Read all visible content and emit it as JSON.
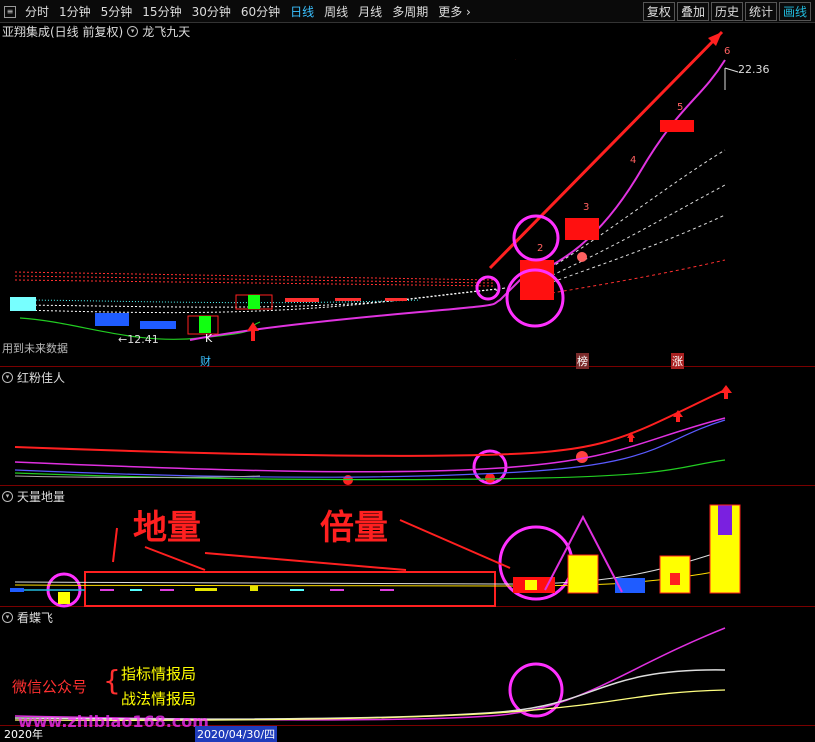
{
  "toolbar": {
    "periods": [
      "分时",
      "1分钟",
      "5分钟",
      "15分钟",
      "30分钟",
      "60分钟",
      "日线",
      "周线",
      "月线",
      "多周期",
      "更多"
    ],
    "active_period": "日线",
    "right_buttons": [
      "复权",
      "叠加",
      "历史",
      "统计",
      "画线"
    ]
  },
  "main_panel": {
    "stock_title": "亚翔集成(日线 前复权)",
    "indicator": "龙飞九天",
    "high_label": "22.36",
    "low_label": "12.41",
    "future_data_label": "用到未来数据",
    "k_label": "K",
    "wave_numbers": [
      "2",
      "3",
      "4",
      "5",
      "6"
    ],
    "bottom_tags": [
      "财",
      "榜",
      "涨"
    ]
  },
  "panel2": {
    "title": "红粉佳人"
  },
  "panel3": {
    "title": "天量地量",
    "annot_diliang": "地量",
    "annot_beiliang": "倍量"
  },
  "panel4": {
    "title": "看蝶飞",
    "wechat_label": "微信公众号",
    "account1": "指标情报局",
    "account2": "战法情报局",
    "watermark": "www.zhibiao168.com"
  },
  "axis": {
    "year_label": "2020年",
    "date_label": "2020/04/30/四"
  },
  "colors": {
    "accent_red": "#ff2020",
    "magenta": "#ff30ff",
    "panel_divider": "#7a0000",
    "active_tab": "#3ac0ff",
    "yellow": "#ffff00"
  }
}
